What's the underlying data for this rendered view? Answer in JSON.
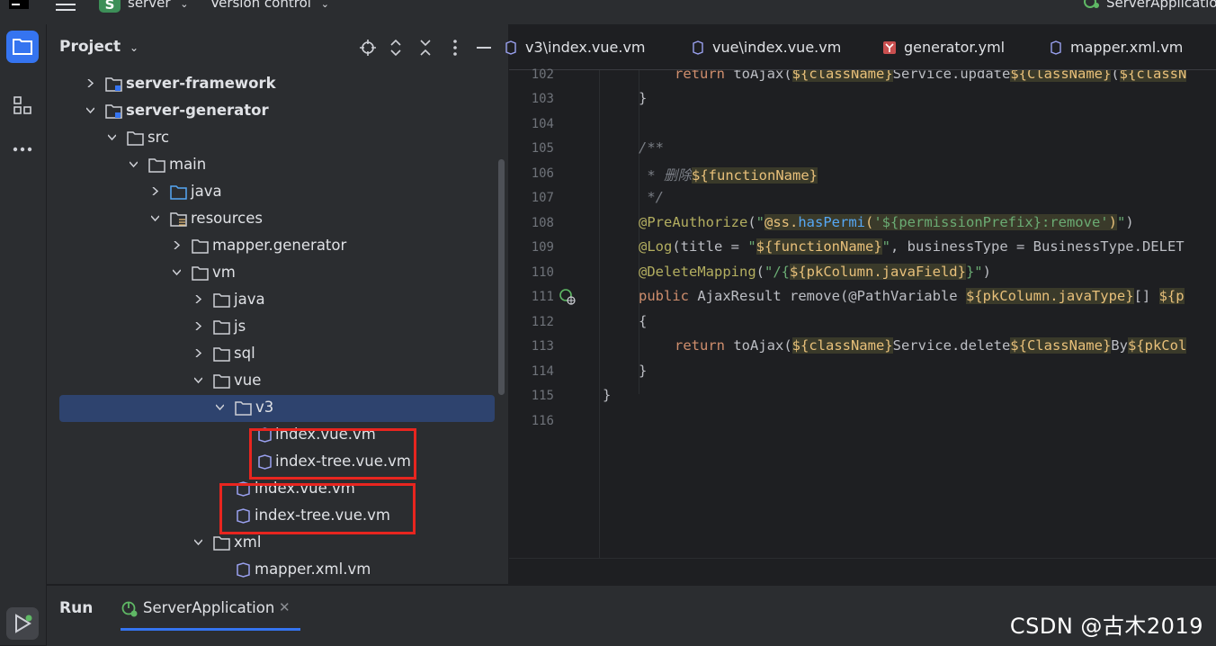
{
  "titlebar": {
    "project_badge": "S",
    "project_name": "server",
    "vcs": "Version control",
    "run_config": "ServerApplicatio"
  },
  "project_panel": {
    "title": "Project",
    "tree": [
      {
        "label": "server-framework"
      },
      {
        "label": "server-generator"
      },
      {
        "label": "src"
      },
      {
        "label": "main"
      },
      {
        "label": "java"
      },
      {
        "label": "resources"
      },
      {
        "label": "mapper.generator"
      },
      {
        "label": "vm"
      },
      {
        "label": "java"
      },
      {
        "label": "js"
      },
      {
        "label": "sql"
      },
      {
        "label": "vue"
      },
      {
        "label": "v3"
      },
      {
        "label": "index.vue.vm"
      },
      {
        "label": "index-tree.vue.vm"
      },
      {
        "label": "index.vue.vm"
      },
      {
        "label": "index-tree.vue.vm"
      },
      {
        "label": "xml"
      },
      {
        "label": "mapper.xml.vm"
      }
    ]
  },
  "editor": {
    "tabs": [
      {
        "label": "v3\\index.vue.vm"
      },
      {
        "label": "vue\\index.vue.vm"
      },
      {
        "label": "generator.yml"
      },
      {
        "label": "mapper.xml.vm"
      }
    ],
    "line_numbers": [
      "102",
      "103",
      "104",
      "105",
      "106",
      "107",
      "108",
      "109",
      "110",
      "111",
      "112",
      "113",
      "114",
      "115",
      "116"
    ]
  },
  "run_panel": {
    "title": "Run",
    "tab_label": "ServerApplication"
  },
  "watermark": "CSDN @古木2019",
  "colors": {
    "accent": "#3574f0",
    "highlight_box": "#e8251f",
    "selection": "#2e436e"
  }
}
